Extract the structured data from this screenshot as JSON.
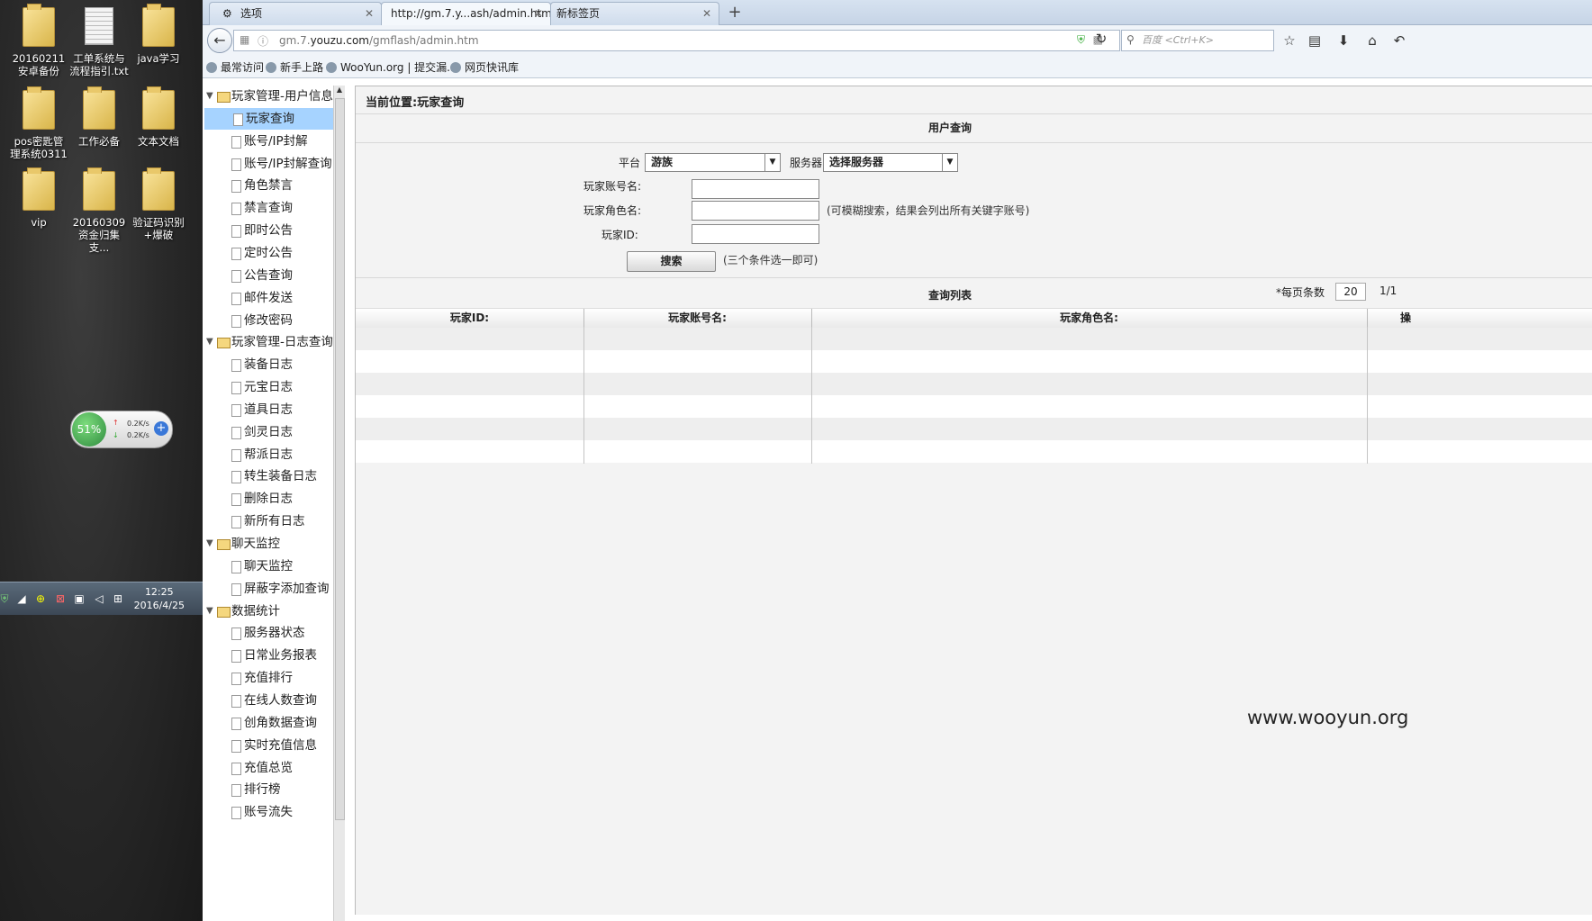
{
  "desktop": {
    "icons": [
      {
        "label": "20160211安卓备份",
        "type": "folder"
      },
      {
        "label": "工单系统与流程指引.txt",
        "type": "text-file"
      },
      {
        "label": "java学习",
        "type": "folder"
      },
      {
        "label": "pos密匙管理系统0311",
        "type": "folder"
      },
      {
        "label": "工作必备",
        "type": "folder"
      },
      {
        "label": "文本文档",
        "type": "folder"
      },
      {
        "label": "vip",
        "type": "folder"
      },
      {
        "label": "20160309资金归集 支...",
        "type": "folder"
      },
      {
        "label": "验证码识别+爆破",
        "type": "folder"
      }
    ],
    "net_widget": {
      "percent": "51%",
      "up": "0.2K/s",
      "down": "0.2K/s"
    },
    "taskbar": {
      "time": "12:25",
      "date": "2016/4/25"
    }
  },
  "browser": {
    "tabs": [
      {
        "label": "选项",
        "active": false
      },
      {
        "label": "http://gm.7.y...ash/admin.htm",
        "active": true
      },
      {
        "label": "新标签页",
        "active": false
      }
    ],
    "new_tab_label": "+",
    "url_prefix": "gm.7.",
    "url_domain": "youzu.com",
    "url_path": "/gmflash/admin.htm",
    "search_placeholder": "百度 <Ctrl+K>",
    "bookmarks": [
      "最常访问",
      "新手上路",
      "WooYun.org | 提交漏...",
      "网页快讯库"
    ]
  },
  "tree": {
    "nodes": [
      {
        "kind": "folder",
        "label": "玩家管理-用户信息"
      },
      {
        "kind": "page",
        "label": "玩家查询",
        "selected": true
      },
      {
        "kind": "page",
        "label": "账号/IP封解"
      },
      {
        "kind": "page",
        "label": "账号/IP封解查询"
      },
      {
        "kind": "page",
        "label": "角色禁言"
      },
      {
        "kind": "page",
        "label": "禁言查询"
      },
      {
        "kind": "page",
        "label": "即时公告"
      },
      {
        "kind": "page",
        "label": "定时公告"
      },
      {
        "kind": "page",
        "label": "公告查询"
      },
      {
        "kind": "page",
        "label": "邮件发送"
      },
      {
        "kind": "page",
        "label": "修改密码"
      },
      {
        "kind": "folder",
        "label": "玩家管理-日志查询"
      },
      {
        "kind": "page",
        "label": "装备日志"
      },
      {
        "kind": "page",
        "label": "元宝日志"
      },
      {
        "kind": "page",
        "label": "道具日志"
      },
      {
        "kind": "page",
        "label": "剑灵日志"
      },
      {
        "kind": "page",
        "label": "帮派日志"
      },
      {
        "kind": "page",
        "label": "转生装备日志"
      },
      {
        "kind": "page",
        "label": "删除日志"
      },
      {
        "kind": "page",
        "label": "新所有日志"
      },
      {
        "kind": "folder",
        "label": "聊天监控"
      },
      {
        "kind": "page",
        "label": "聊天监控"
      },
      {
        "kind": "page",
        "label": "屏蔽字添加查询"
      },
      {
        "kind": "folder",
        "label": "数据统计"
      },
      {
        "kind": "page",
        "label": "服务器状态"
      },
      {
        "kind": "page",
        "label": "日常业务报表"
      },
      {
        "kind": "page",
        "label": "充值排行"
      },
      {
        "kind": "page",
        "label": "在线人数查询"
      },
      {
        "kind": "page",
        "label": "创角数据查询"
      },
      {
        "kind": "page",
        "label": "实时充值信息"
      },
      {
        "kind": "page",
        "label": "充值总览"
      },
      {
        "kind": "page",
        "label": "排行榜"
      },
      {
        "kind": "page",
        "label": "账号流失"
      }
    ]
  },
  "main": {
    "breadcrumb": "当前位置:玩家查询",
    "query_title": "用户查询",
    "platform_label": "平台",
    "platform_value": "游族",
    "server_label": "服务器",
    "server_value": "选择服务器",
    "account_label": "玩家账号名:",
    "role_label": "玩家角色名:",
    "fuzzy_note": "(可模糊搜索，结果会列出所有关键字账号)",
    "id_label": "玩家ID:",
    "search_button": "搜索",
    "condition_note": "(三个条件选一即可)",
    "list_title": "查询列表",
    "per_page_label": "*每页条数",
    "per_page_value": "20",
    "page_info": "1/1",
    "columns": [
      "玩家ID:",
      "玩家账号名:",
      "玩家角色名:",
      "操"
    ]
  },
  "watermark": "www.wooyun.org"
}
